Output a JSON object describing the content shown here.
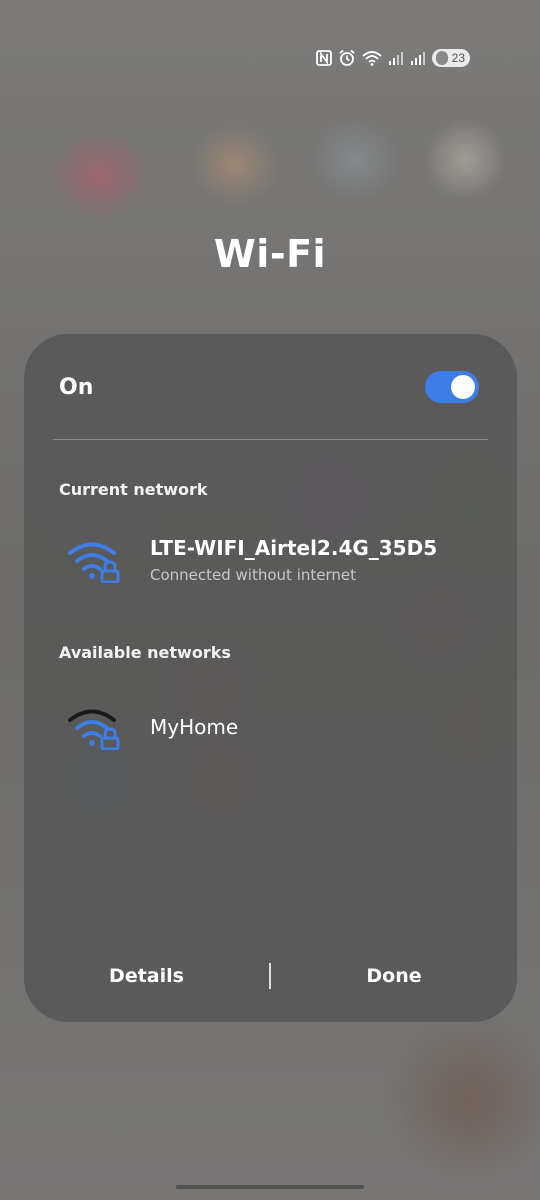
{
  "status_bar": {
    "icons": [
      "nfc-icon",
      "alarm-icon",
      "wifi-icon",
      "signal-icon",
      "signal-icon",
      "battery-icon"
    ],
    "battery_level": "23"
  },
  "title": "Wi-Fi",
  "toggle": {
    "label": "On",
    "state": "on",
    "accent_color": "#3d7de8"
  },
  "current_network": {
    "header": "Current network",
    "name": "LTE-WIFI_Airtel2.4G_35D5",
    "status": "Connected without internet",
    "icon": "wifi-lock-icon"
  },
  "available_networks": {
    "header": "Available networks",
    "items": [
      {
        "name": "MyHome",
        "icon": "wifi-lock-icon"
      }
    ]
  },
  "footer": {
    "details_label": "Details",
    "done_label": "Done"
  }
}
